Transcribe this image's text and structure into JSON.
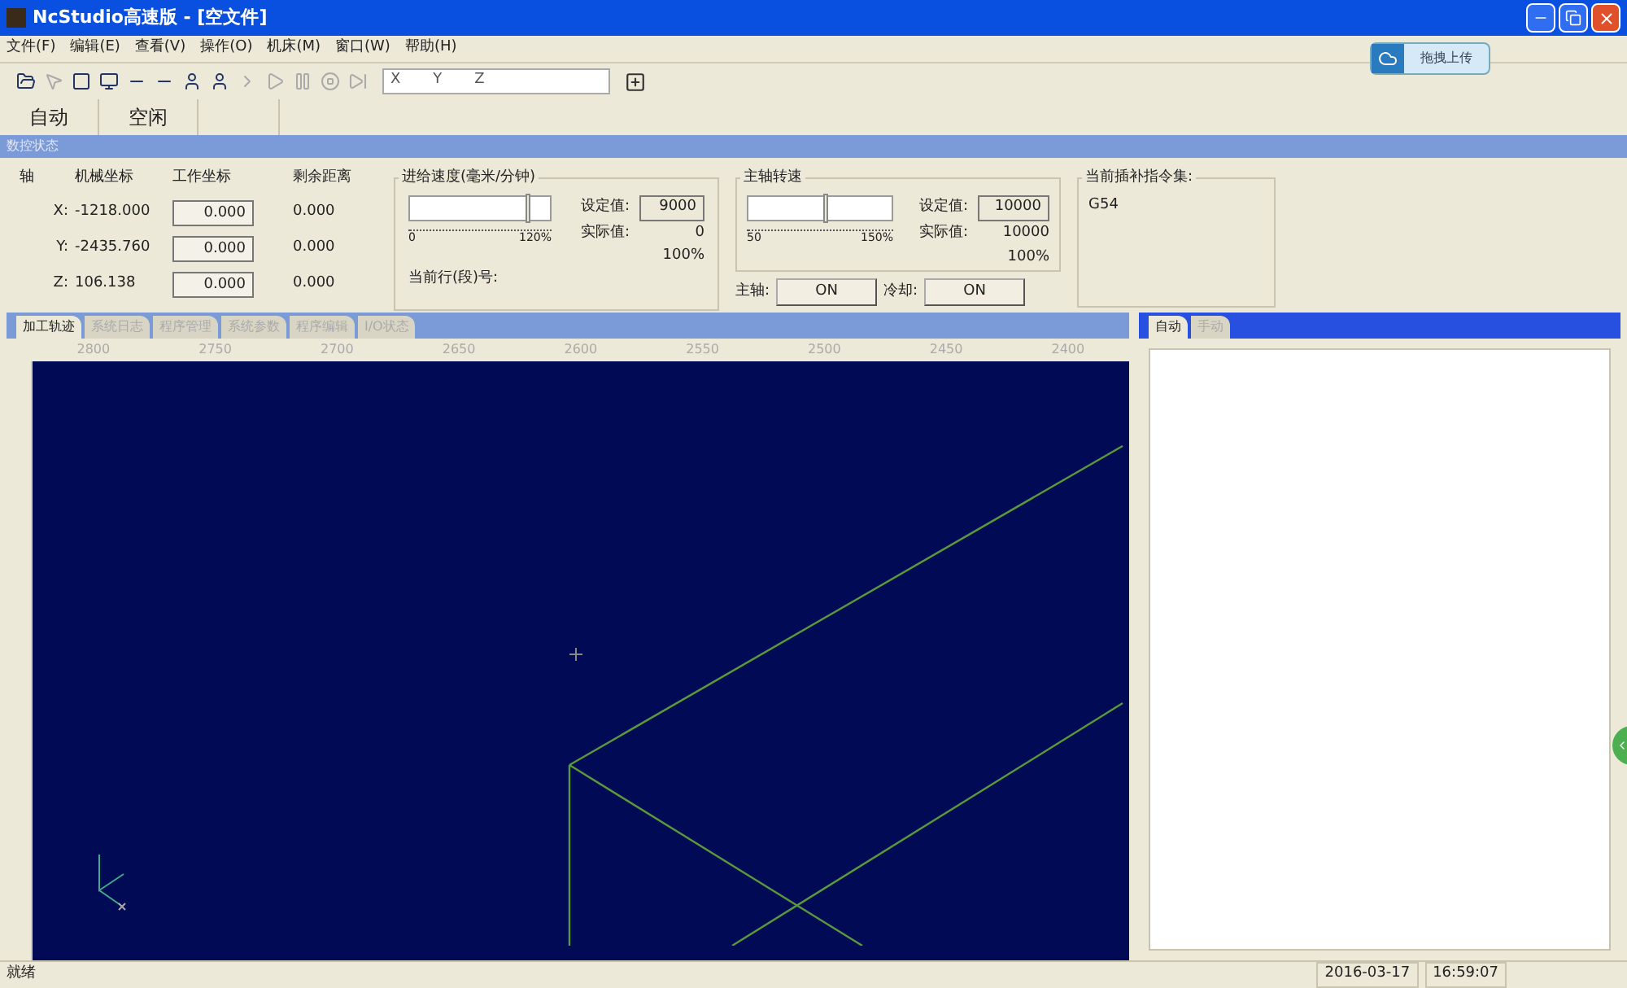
{
  "window": {
    "title": "NcStudio高速版 - [空文件]"
  },
  "menu": [
    "文件(F)",
    "编辑(E)",
    "查看(V)",
    "操作(O)",
    "机床(M)",
    "窗口(W)",
    "帮助(H)"
  ],
  "upload_button": {
    "label": "拖拽上传"
  },
  "toolbar": [
    {
      "kind": "open",
      "disabled": false
    },
    {
      "kind": "select",
      "disabled": true
    },
    {
      "kind": "window",
      "disabled": false
    },
    {
      "kind": "monitor",
      "disabled": false
    },
    {
      "kind": "axis",
      "disabled": false
    },
    {
      "kind": "axis",
      "disabled": false
    },
    {
      "kind": "person",
      "disabled": false
    },
    {
      "kind": "person",
      "disabled": false
    },
    {
      "kind": "step",
      "disabled": true
    },
    {
      "kind": "play",
      "disabled": true
    },
    {
      "kind": "pause",
      "disabled": true
    },
    {
      "kind": "stop",
      "disabled": true
    },
    {
      "kind": "next",
      "disabled": true
    }
  ],
  "coord_field": [
    "X",
    "Y",
    "Z"
  ],
  "modes": [
    "自动",
    "空闲"
  ],
  "status_header": "数控状态",
  "axes": {
    "headers": [
      "轴",
      "机械坐标",
      "工作坐标",
      "剩余距离"
    ],
    "rows": [
      {
        "axis": "X:",
        "machine": "-1218.000",
        "work": "0.000",
        "remaining": "0.000"
      },
      {
        "axis": "Y:",
        "machine": "-2435.760",
        "work": "0.000",
        "remaining": "0.000"
      },
      {
        "axis": "Z:",
        "machine": "106.138",
        "work": "0.000",
        "remaining": "0.000"
      }
    ]
  },
  "feed": {
    "title": "进给速度(毫米/分钟)",
    "level": 0.85,
    "min": "0",
    "max": "120%",
    "set_label": "设定值:",
    "set_value": "9000",
    "actual_label": "实际值:",
    "actual_value": "0",
    "percent": "100%",
    "line_label": "当前行(段)号:"
  },
  "spindle": {
    "title": "主轴转速",
    "level": 0.55,
    "min": "50",
    "max": "150%",
    "set_label": "设定值:",
    "set_value": "10000",
    "actual_label": "实际值:",
    "actual_value": "10000",
    "percent": "100%"
  },
  "switches": [
    {
      "label": "主轴:",
      "button": "ON"
    },
    {
      "label": "冷却:",
      "button": "ON"
    }
  ],
  "gcode": {
    "title": "当前插补指令集:",
    "value": "G54"
  },
  "tabs": [
    {
      "label": "加工轨迹",
      "selected": true
    },
    {
      "label": "系统日志",
      "selected": false
    },
    {
      "label": "程序管理",
      "selected": false
    },
    {
      "label": "系统参数",
      "selected": false
    },
    {
      "label": "程序编辑",
      "selected": false
    },
    {
      "label": "I/O状态",
      "selected": false
    }
  ],
  "ruler": [
    "2800",
    "2750",
    "2700",
    "2650",
    "2600",
    "2550",
    "2500",
    "2450",
    "2400"
  ],
  "side_tabs": [
    {
      "label": "自动",
      "selected": true
    },
    {
      "label": "手动",
      "selected": false
    }
  ],
  "status_bar": {
    "message": "就绪",
    "date": "2016-03-17",
    "time": "16:59:07"
  }
}
